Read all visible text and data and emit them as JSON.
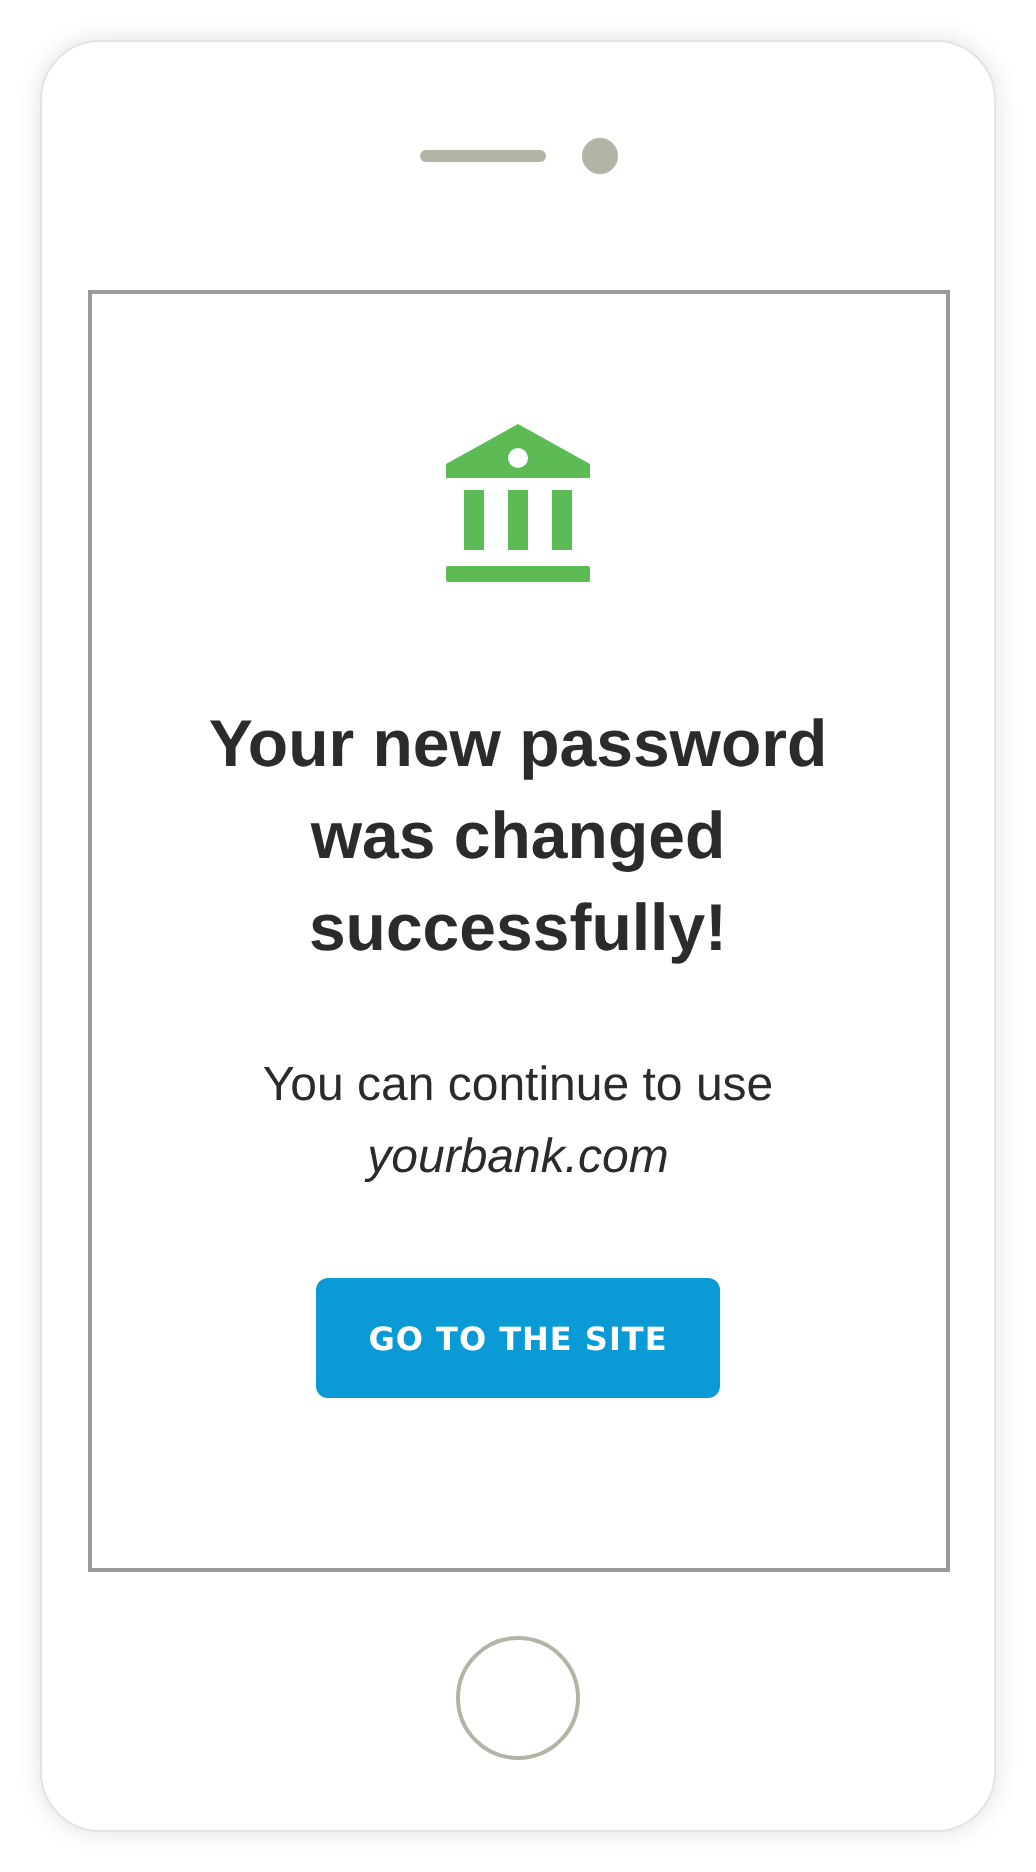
{
  "screen": {
    "title": "Your new password was changed successfully!",
    "message": "You can continue to use *yourbank.com*",
    "button": {
      "label": "GO TO THE SITE"
    }
  }
}
